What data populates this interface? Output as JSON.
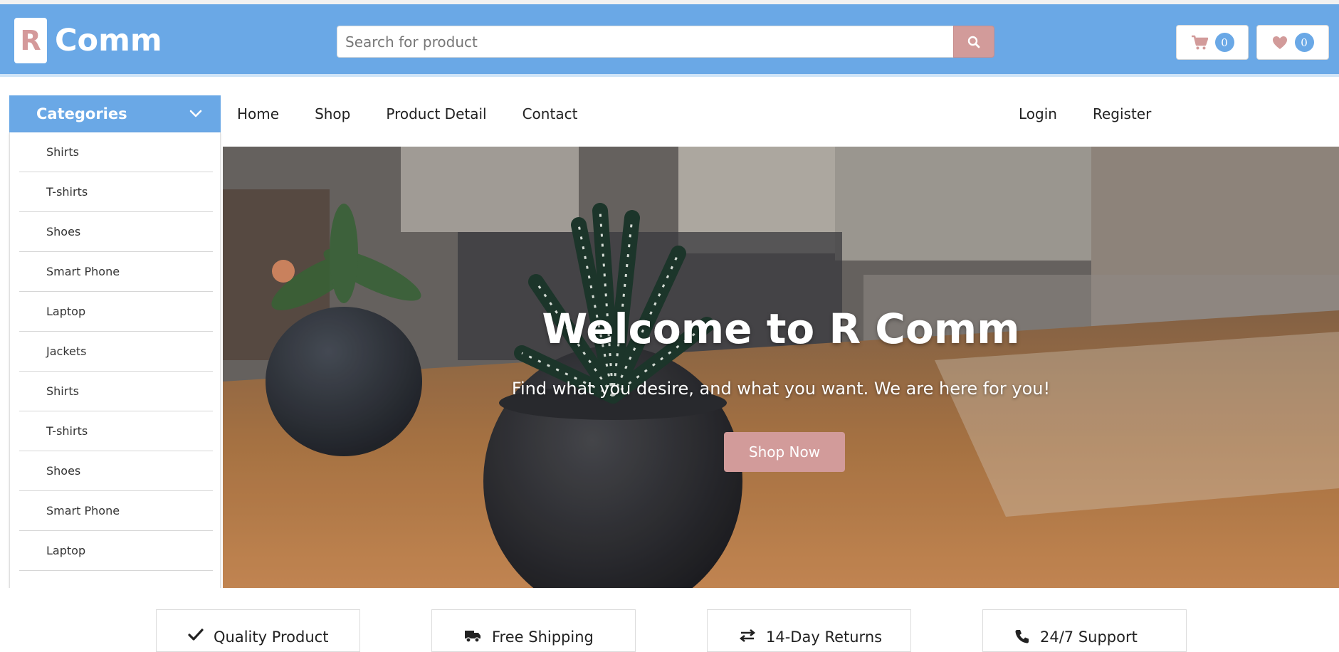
{
  "brand": {
    "logo_letter": "R",
    "name": "Comm"
  },
  "search": {
    "placeholder": "Search for product"
  },
  "header_buttons": {
    "cart_count": "0",
    "wishlist_count": "0"
  },
  "categories": {
    "label": "Categories",
    "items": [
      "Shirts",
      "T-shirts",
      "Shoes",
      "Smart Phone",
      "Laptop",
      "Jackets",
      "Shirts",
      "T-shirts",
      "Shoes",
      "Smart Phone",
      "Laptop"
    ]
  },
  "nav": {
    "left": [
      "Home",
      "Shop",
      "Product Detail",
      "Contact"
    ],
    "right": [
      "Login",
      "Register"
    ]
  },
  "hero": {
    "title": "Welcome to R Comm",
    "subtitle": "Find what you desire, and what you want. We are here for you!",
    "cta": "Shop Now"
  },
  "features": [
    "Quality Product",
    "Free Shipping",
    "14-Day Returns",
    "24/7 Support"
  ],
  "colors": {
    "primary": "#6aa8e6",
    "accent": "#d29b9a"
  }
}
